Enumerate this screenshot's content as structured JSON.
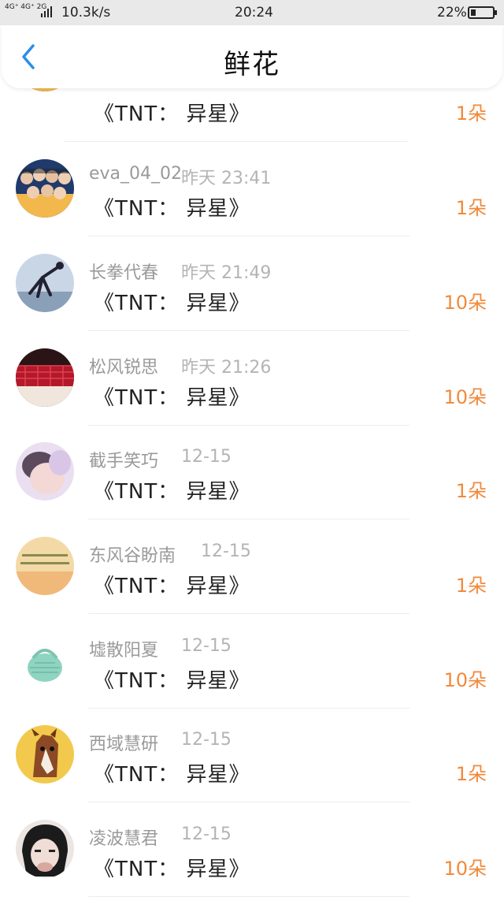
{
  "status_bar": {
    "network_type": "4G⁺ 4G⁺ 2G",
    "speed": "10.3k/s",
    "time": "20:24",
    "battery": "22%",
    "battery_level": 0.22
  },
  "header": {
    "back_icon": "chevron-left-icon",
    "title": "鲜花"
  },
  "colors": {
    "accent": "#f08a3c",
    "back": "#2b8fe8"
  },
  "gifts": [
    {
      "name": "",
      "time": "",
      "item": "《TNT： 异星》",
      "quantity": "1朵",
      "avatar": "group-photo"
    },
    {
      "name": "eva_04_02",
      "time": "昨天 23:41",
      "item": "《TNT： 异星》",
      "quantity": "1朵",
      "avatar": "group-photo"
    },
    {
      "name": "长拳代春",
      "time": "昨天 21:49",
      "item": "《TNT： 异星》",
      "quantity": "10朵",
      "avatar": "dancer-photo"
    },
    {
      "name": "松风锐思",
      "time": "昨天 21:26",
      "item": "《TNT： 异星》",
      "quantity": "10朵",
      "avatar": "red-curtain-photo"
    },
    {
      "name": "截手笑巧",
      "time": "12-15",
      "item": "《TNT： 异星》",
      "quantity": "1朵",
      "avatar": "portrait-photo"
    },
    {
      "name": "东风谷盼南",
      "time": "12-15",
      "item": "《TNT： 异星》",
      "quantity": "1朵",
      "avatar": "sunset-text-photo"
    },
    {
      "name": "墟散阳夏",
      "time": "12-15",
      "item": "《TNT： 异星》",
      "quantity": "10朵",
      "avatar": "knit-bag-photo"
    },
    {
      "name": "西域慧研",
      "time": "12-15",
      "item": "《TNT： 异星》",
      "quantity": "1朵",
      "avatar": "horse-cartoon"
    },
    {
      "name": "凌波慧君",
      "time": "12-15",
      "item": "《TNT： 异星》",
      "quantity": "10朵",
      "avatar": "anime-portrait"
    }
  ]
}
